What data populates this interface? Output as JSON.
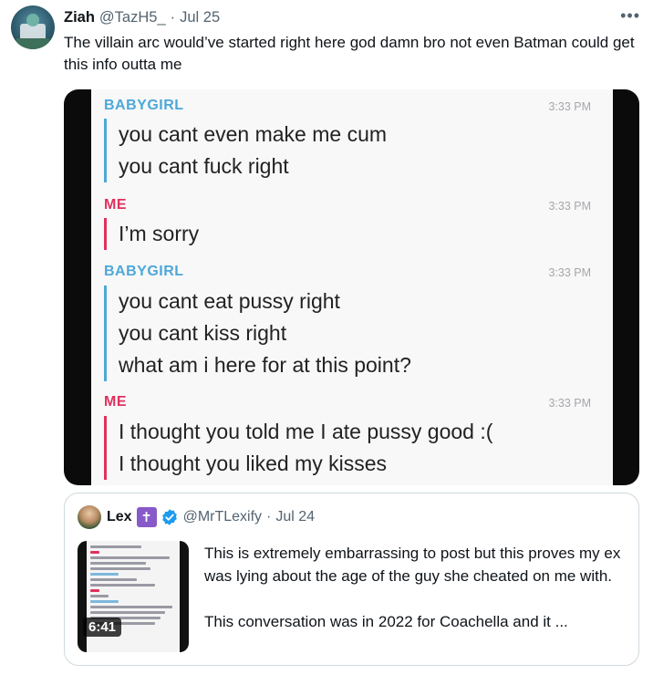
{
  "tweet": {
    "author_name": "Ziah",
    "handle": "@TazH5_",
    "separator": "·",
    "date": "Jul 25",
    "more_icon": "more-horizontal-icon",
    "text": "The villain arc would’ve started right here god damn bro not even Batman could get this info outta me"
  },
  "screenshot": {
    "blocks": [
      {
        "sender": "BABYGIRL",
        "time": "3:33 PM",
        "messages": [
          "you cant even make me cum",
          "you cant fuck right"
        ]
      },
      {
        "sender": "ME",
        "time": "3:33 PM",
        "messages": [
          "I’m sorry"
        ]
      },
      {
        "sender": "BABYGIRL",
        "time": "3:33 PM",
        "messages": [
          "you cant eat pussy right",
          "you cant kiss right",
          "what am i here for at this point?"
        ]
      },
      {
        "sender": "ME",
        "time": "3:33 PM",
        "messages": [
          "I thought you told me I ate pussy good :(",
          "I thought you liked my kisses"
        ]
      }
    ],
    "colors": {
      "babygirl": "#4da8d8",
      "me": "#e0315e"
    }
  },
  "quote": {
    "author_name": "Lex",
    "badge": "✝",
    "verified_icon": "verified-badge-icon",
    "handle": "@MrTLexify",
    "separator": "·",
    "date": "Jul 24",
    "video_duration": "6:41",
    "text_line1": "This is extremely embarrassing to post but this proves my ex was lying about the age of the guy she cheated on me with.",
    "text_line2": "This conversation was in 2022 for Coachella and it ..."
  }
}
